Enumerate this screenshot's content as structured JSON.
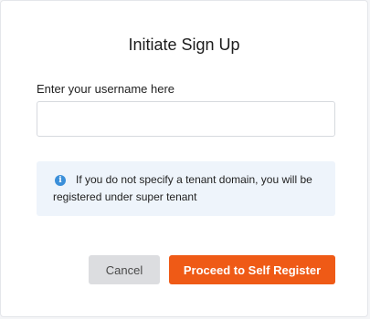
{
  "dialog": {
    "title": "Initiate Sign Up",
    "username_label": "Enter your username here",
    "username_value": "",
    "username_placeholder": "",
    "info": {
      "icon": "info-icon",
      "text": "If you do not specify a tenant domain, you will be registered under super tenant"
    },
    "cancel_label": "Cancel",
    "proceed_label": "Proceed to Self Register"
  },
  "colors": {
    "accent": "#ef5a16",
    "info_background": "#eef4fb",
    "info_icon": "#3b8fd9",
    "cancel_background": "#dcdde0"
  }
}
